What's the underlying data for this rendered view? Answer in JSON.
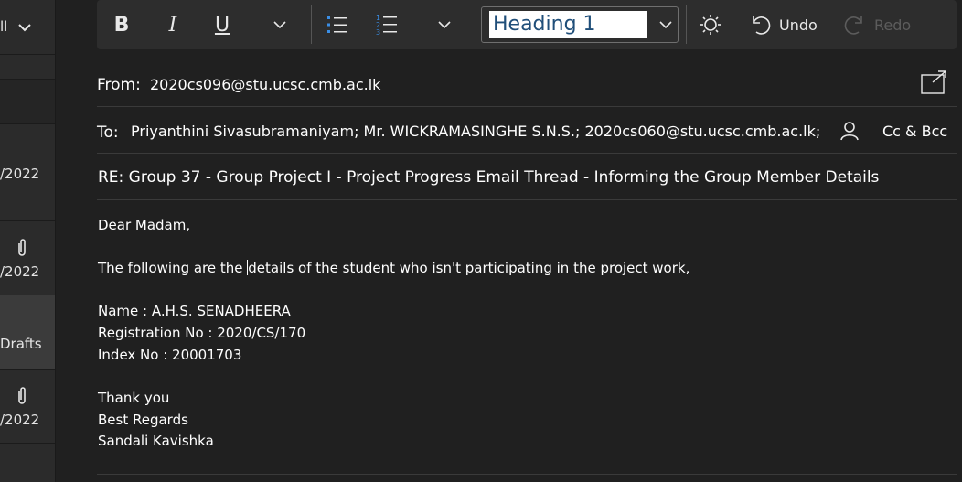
{
  "sidebar": {
    "rows": [
      {
        "text": "ll"
      },
      {
        "text": ""
      },
      {
        "text": "/2022"
      },
      {
        "text": "/2022"
      },
      {
        "text": "Drafts"
      },
      {
        "text": "/2022"
      }
    ]
  },
  "toolbar": {
    "bold_icon": "bold-icon",
    "italic_icon": "italic-icon",
    "underline_icon": "underline-icon",
    "style": "Heading 1",
    "undo_label": "Undo",
    "redo_label": "Redo",
    "accent_color": "#3a8ee6"
  },
  "compose": {
    "from_label": "From:",
    "from_value": "2020cs096@stu.ucsc.cmb.ac.lk",
    "to_label": "To:",
    "to_value": "Priyanthini Sivasubramaniyam; Mr. WICKRAMASINGHE S.N.S.; 2020cs060@stu.ucsc.cmb.ac.lk;",
    "cc_bcc_label": "Cc & Bcc",
    "subject": "RE: Group 37 - Group Project I - Project Progress Email Thread - Informing the Group Member Details"
  },
  "body": {
    "greeting": "Dear Madam,",
    "line1_before": "The following are the ",
    "line1_after": "details of the student who isn't participating in the project work,",
    "name_line": "Name :  A.H.S. SENADHEERA",
    "reg_line": "Registration No :  2020/CS/170",
    "index_line": "Index  No :  20001703",
    "thanks": "Thank you",
    "regards": "Best Regards",
    "signature": "Sandali Kavishka"
  }
}
